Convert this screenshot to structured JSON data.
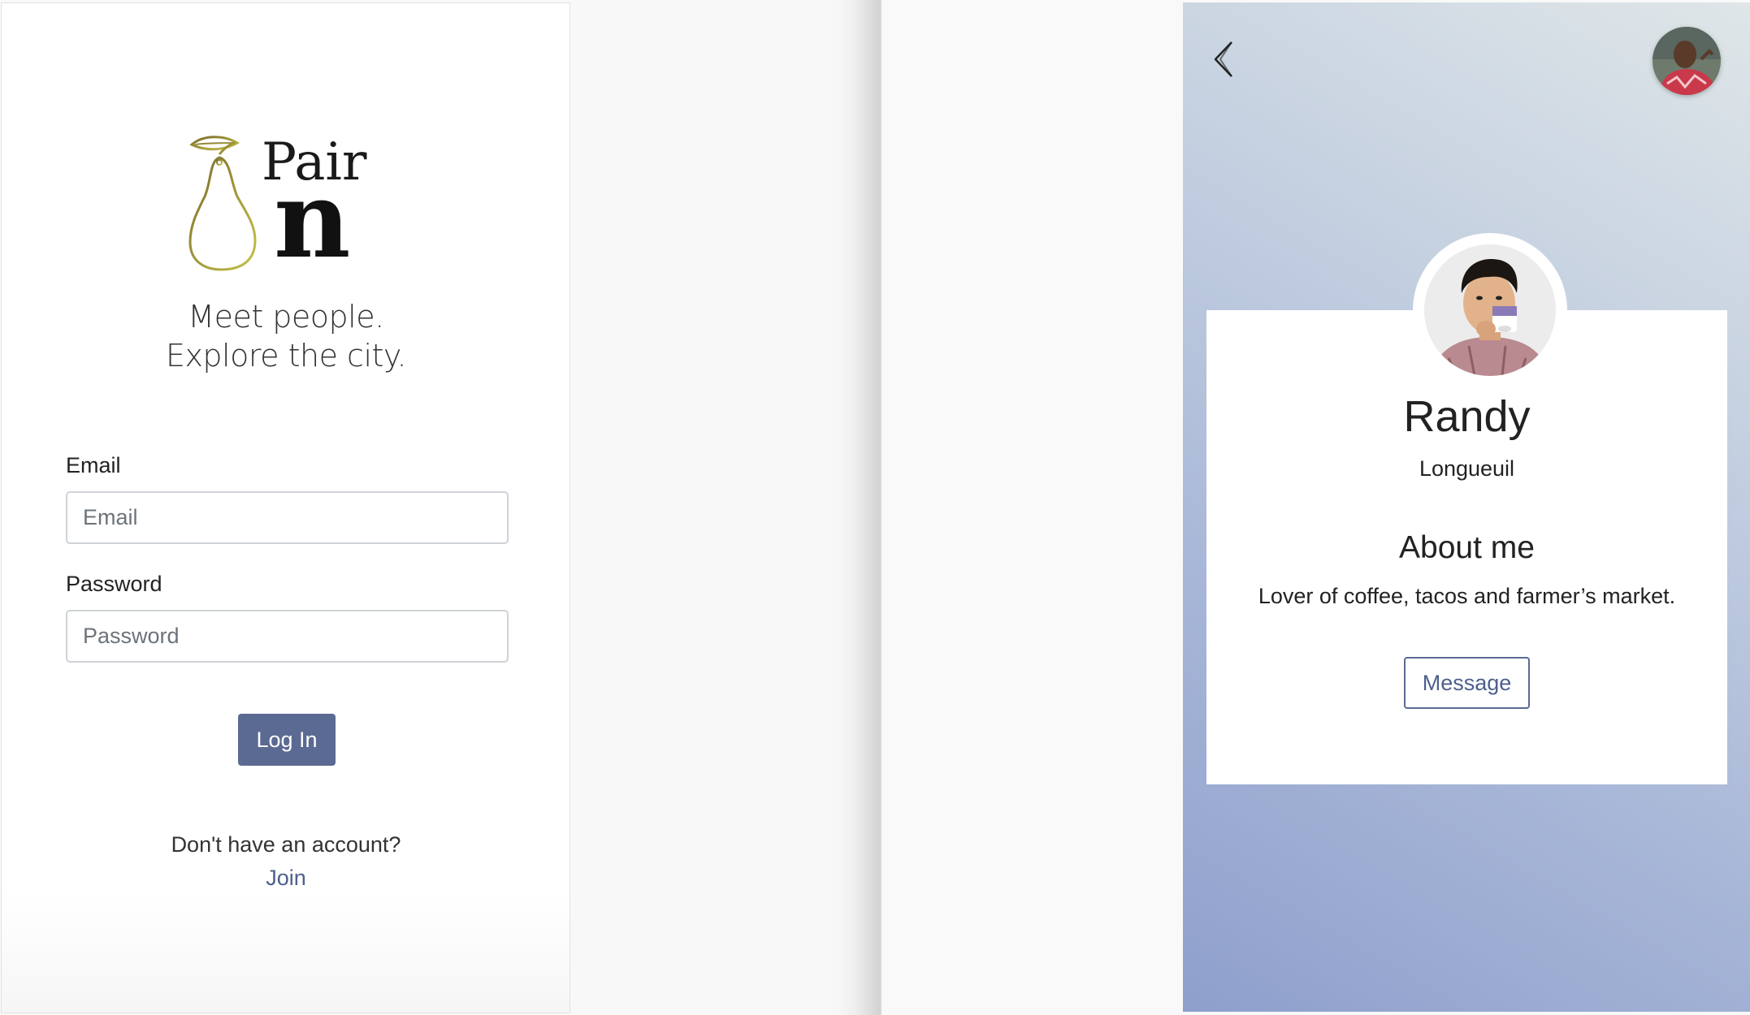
{
  "login": {
    "logo_text_top": "Pair",
    "logo_text_bottom": "n",
    "tagline_line1": "Meet people.",
    "tagline_line2": "Explore the city.",
    "email_label": "Email",
    "email_placeholder": "Email",
    "email_value": "",
    "password_label": "Password",
    "password_placeholder": "Password",
    "password_value": "",
    "login_button": "Log In",
    "signup_prompt": "Don't have an account?",
    "join_link": "Join"
  },
  "profile": {
    "back_icon": "chevron-left-icon",
    "current_user_avatar": "avatar",
    "name": "Randy",
    "city": "Longueuil",
    "about_heading": "About me",
    "about_text": "Lover of coffee, tacos and farmer’s market.",
    "message_button": "Message"
  },
  "colors": {
    "primary_button": "#5b6a92",
    "link": "#4e5f8c",
    "gradient_start": "#8e9fcc",
    "gradient_end": "#dfe6e8",
    "logo_pear": "#a8a23a"
  }
}
